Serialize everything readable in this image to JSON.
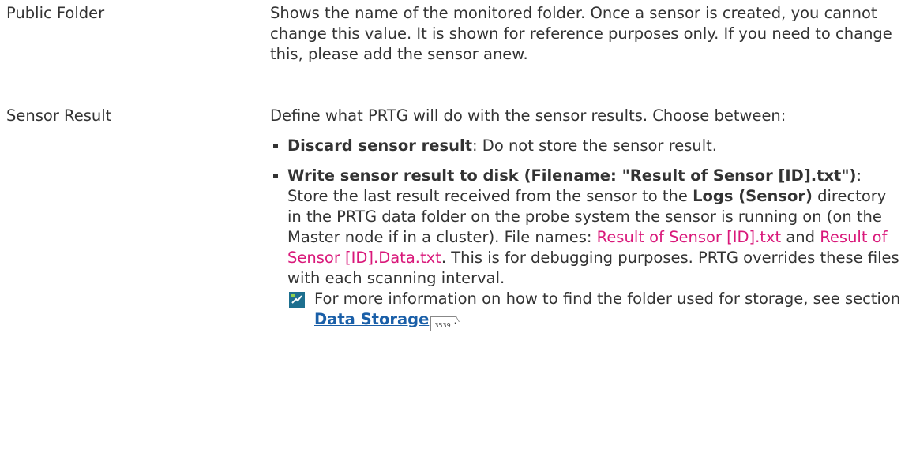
{
  "rows": [
    {
      "label": "Public Folder",
      "description": "Shows the name of the monitored folder. Once a sensor is created, you cannot change this value. It is shown for reference purposes only. If you need to change this, please add the sensor anew."
    },
    {
      "label": "Sensor Result",
      "intro": "Define what PRTG will do with the sensor results. Choose between:",
      "options": [
        {
          "title": "Discard sensor result",
          "text": ": Do not store the sensor result."
        },
        {
          "title": "Write sensor result to disk (Filename: \"Result of Sensor [ID].txt\")",
          "text_1": ": Store the last result received from the sensor to the ",
          "dir_name": "Logs (Sensor)",
          "text_2": " directory in the PRTG data folder on the probe system the sensor is running on (on the Master node if in a cluster). File names: ",
          "file_1": "Result of Sensor [ID].txt",
          "text_3": " and ",
          "file_2": "Result of Sensor [ID].Data.txt",
          "text_4": ". This is for debugging purposes. PRTG overrides these files with each scanning interval."
        }
      ],
      "note": {
        "text": "For more information on how to find the folder used for storage, see section ",
        "link_label": "Data Storage",
        "page_ref": "3539",
        "end": "."
      }
    }
  ],
  "colors": {
    "text": "#333333",
    "highlight": "#d9187a",
    "link": "#1a5fa8",
    "note_icon": "#1d6f8f"
  },
  "icons": {
    "note": "info-note-icon",
    "bullet": "square-bullet"
  }
}
